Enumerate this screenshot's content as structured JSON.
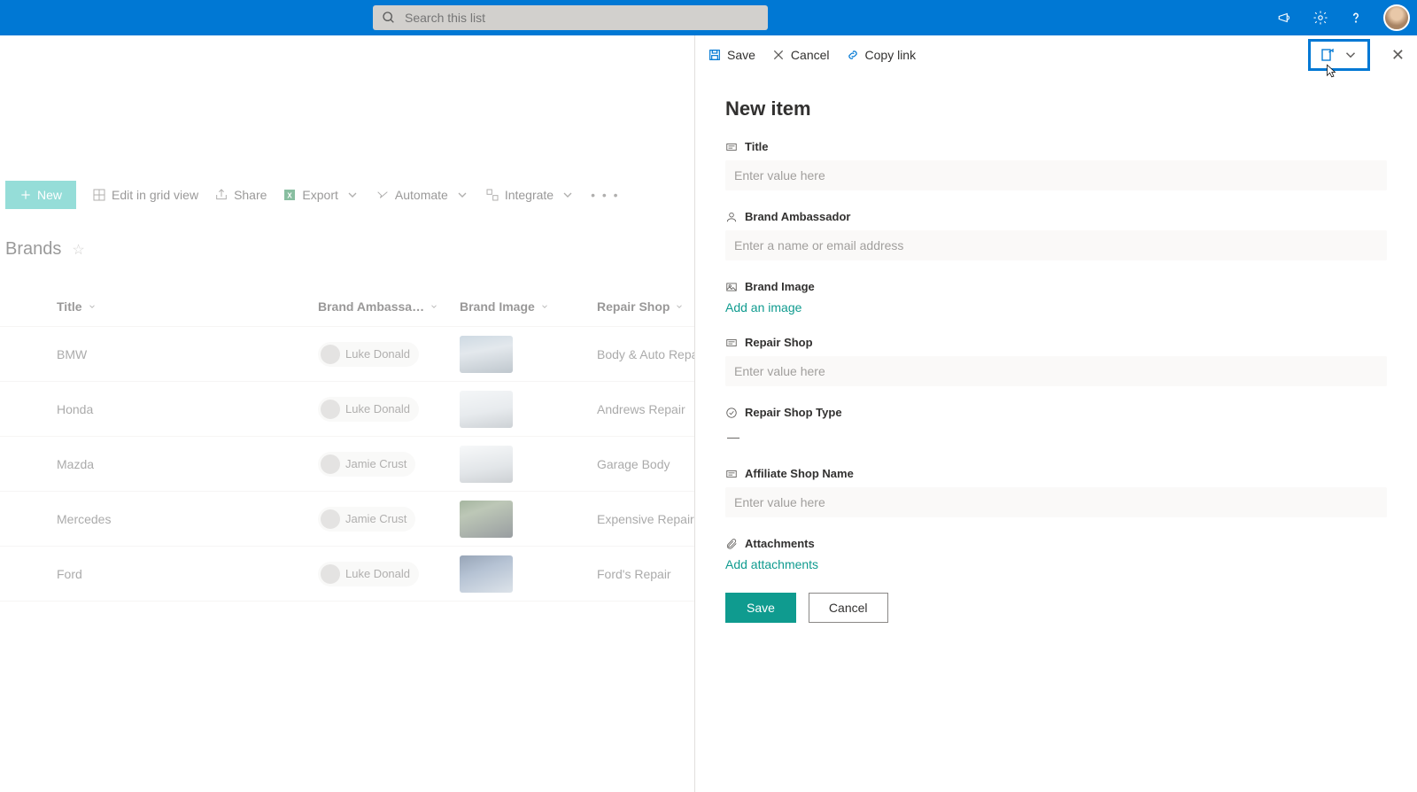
{
  "topbar": {
    "search_placeholder": "Search this list"
  },
  "toolbar": {
    "new": "New",
    "edit_grid": "Edit in grid view",
    "share": "Share",
    "export": "Export",
    "automate": "Automate",
    "integrate": "Integrate"
  },
  "list": {
    "title": "Brands",
    "columns": {
      "title": "Title",
      "ambassador": "Brand Ambassa…",
      "image": "Brand Image",
      "shop": "Repair Shop"
    },
    "rows": [
      {
        "title": "BMW",
        "ambassador": "Luke Donald",
        "shop": "Body & Auto Repair",
        "thumb": "linear-gradient(170deg,#9db4c6 0%,#c7d1da 40%,#7f8f9c 100%)"
      },
      {
        "title": "Honda",
        "ambassador": "Luke Donald",
        "shop": "Andrews Repair",
        "thumb": "linear-gradient(170deg,#e9edf0 0%,#cfd6dc 55%,#9aa3ab 100%)"
      },
      {
        "title": "Mazda",
        "ambassador": "Jamie Crust",
        "shop": "Garage Body",
        "thumb": "linear-gradient(170deg,#eef1f3 0%,#c5ccd2 60%,#9aa1a8 100%)"
      },
      {
        "title": "Mercedes",
        "ambassador": "Jamie Crust",
        "shop": "Expensive Repair",
        "thumb": "linear-gradient(160deg,#4a6b3f 0%,#7a8f6e 30%,#323b42 100%)"
      },
      {
        "title": "Ford",
        "ambassador": "Luke Donald",
        "shop": "Ford's Repair",
        "thumb": "linear-gradient(160deg,#2f4a6e 0%,#6c86a8 40%,#b9c6d3 100%)"
      }
    ]
  },
  "panel": {
    "actions": {
      "save": "Save",
      "cancel": "Cancel",
      "copylink": "Copy link"
    },
    "title": "New item",
    "fields": {
      "title": {
        "label": "Title",
        "placeholder": "Enter value here"
      },
      "ambassador": {
        "label": "Brand Ambassador",
        "placeholder": "Enter a name or email address"
      },
      "image": {
        "label": "Brand Image",
        "action": "Add an image"
      },
      "shop": {
        "label": "Repair Shop",
        "placeholder": "Enter value here"
      },
      "shoptype": {
        "label": "Repair Shop Type",
        "value": "—"
      },
      "affiliate": {
        "label": "Affiliate Shop Name",
        "placeholder": "Enter value here"
      },
      "attachments": {
        "label": "Attachments",
        "action": "Add attachments"
      }
    },
    "buttons": {
      "save": "Save",
      "cancel": "Cancel"
    }
  }
}
